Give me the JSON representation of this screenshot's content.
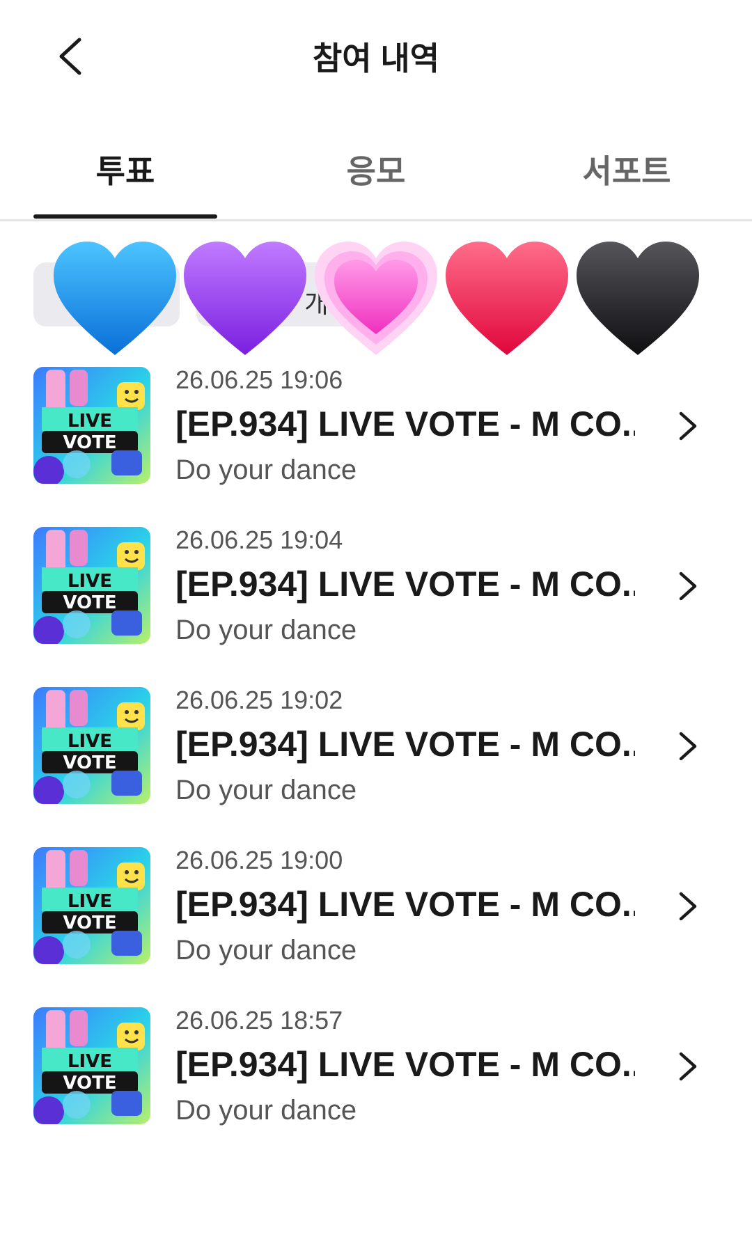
{
  "header": {
    "title": "참여 내역",
    "back_icon": "chevron-left-icon"
  },
  "tabs": [
    {
      "label": "투표",
      "active": true
    },
    {
      "label": "응모",
      "active": false
    },
    {
      "label": "서포트",
      "active": false
    }
  ],
  "filter": {
    "chip_label": "개",
    "hearts": [
      {
        "name": "blue-heart-icon",
        "color": "#1a9cf2"
      },
      {
        "name": "purple-heart-icon",
        "color": "#9d3ff0"
      },
      {
        "name": "pink-heart-icon",
        "color": "#ff5fd2"
      },
      {
        "name": "red-heart-icon",
        "color": "#f5204f"
      },
      {
        "name": "black-heart-icon",
        "color": "#1c1c1f"
      }
    ]
  },
  "items": [
    {
      "date": "26.06.25 19:06",
      "title": "[EP.934] LIVE VOTE - M CO...",
      "subtitle": "Do your dance",
      "thumb_label_1": "LIVE",
      "thumb_label_2": "VOTE"
    },
    {
      "date": "26.06.25 19:04",
      "title": "[EP.934] LIVE VOTE - M CO...",
      "subtitle": "Do your dance",
      "thumb_label_1": "LIVE",
      "thumb_label_2": "VOTE"
    },
    {
      "date": "26.06.25 19:02",
      "title": "[EP.934] LIVE VOTE - M CO...",
      "subtitle": "Do your dance",
      "thumb_label_1": "LIVE",
      "thumb_label_2": "VOTE"
    },
    {
      "date": "26.06.25 19:00",
      "title": "[EP.934] LIVE VOTE - M CO...",
      "subtitle": "Do your dance",
      "thumb_label_1": "LIVE",
      "thumb_label_2": "VOTE"
    },
    {
      "date": "26.06.25 18:57",
      "title": "[EP.934] LIVE VOTE - M CO...",
      "subtitle": "Do your dance",
      "thumb_label_1": "LIVE",
      "thumb_label_2": "VOTE"
    }
  ]
}
